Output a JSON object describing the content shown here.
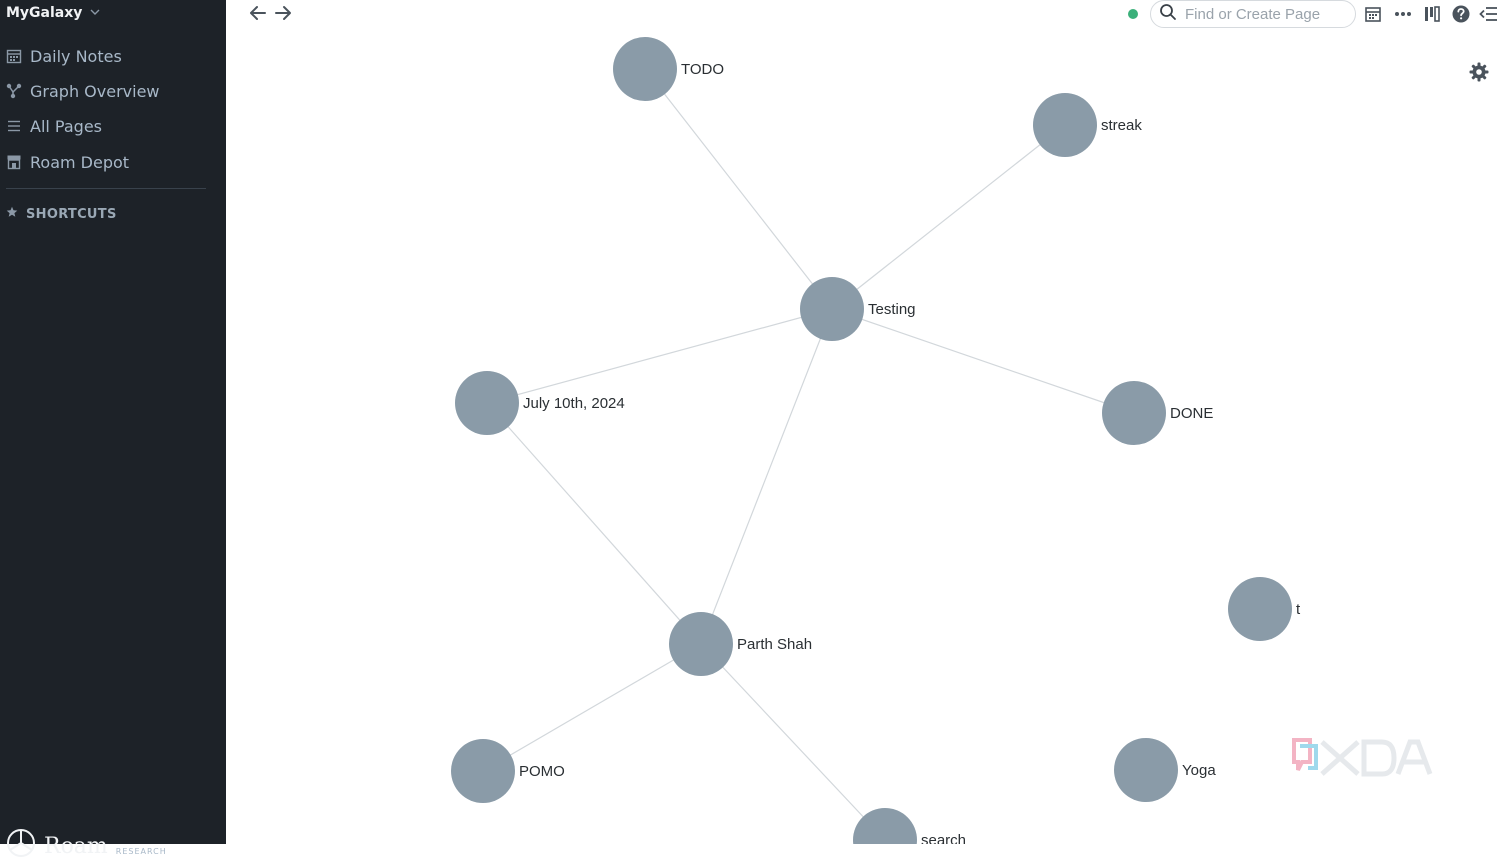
{
  "sidebar": {
    "graph_name": "MyGalaxy",
    "items": [
      {
        "label": "Daily Notes",
        "icon": "calendar-icon"
      },
      {
        "label": "Graph Overview",
        "icon": "graph-icon"
      },
      {
        "label": "All Pages",
        "icon": "list-icon"
      },
      {
        "label": "Roam Depot",
        "icon": "store-icon"
      }
    ],
    "shortcuts_label": "SHORTCUTS",
    "brand": "Roam",
    "brand_sub": "RESEARCH"
  },
  "toolbar": {
    "search_placeholder": "Find or Create Page"
  },
  "graph": {
    "nodes": [
      {
        "id": "todo",
        "label": "TODO"
      },
      {
        "id": "streak",
        "label": "streak"
      },
      {
        "id": "testing",
        "label": "Testing"
      },
      {
        "id": "july",
        "label": "July 10th, 2024"
      },
      {
        "id": "done",
        "label": "DONE"
      },
      {
        "id": "t",
        "label": "t"
      },
      {
        "id": "parth",
        "label": "Parth Shah"
      },
      {
        "id": "pomo",
        "label": "POMO"
      },
      {
        "id": "yoga",
        "label": "Yoga"
      },
      {
        "id": "search",
        "label": "search"
      }
    ],
    "edges": [
      [
        "todo",
        "testing"
      ],
      [
        "streak",
        "testing"
      ],
      [
        "july",
        "testing"
      ],
      [
        "done",
        "testing"
      ],
      [
        "parth",
        "testing"
      ],
      [
        "july",
        "parth"
      ],
      [
        "pomo",
        "parth"
      ],
      [
        "search",
        "parth"
      ]
    ]
  },
  "watermark": "XDA",
  "colors": {
    "sidebar_bg": "#1d2228",
    "node": "#8a9ba8",
    "status": "#3bb07a"
  }
}
